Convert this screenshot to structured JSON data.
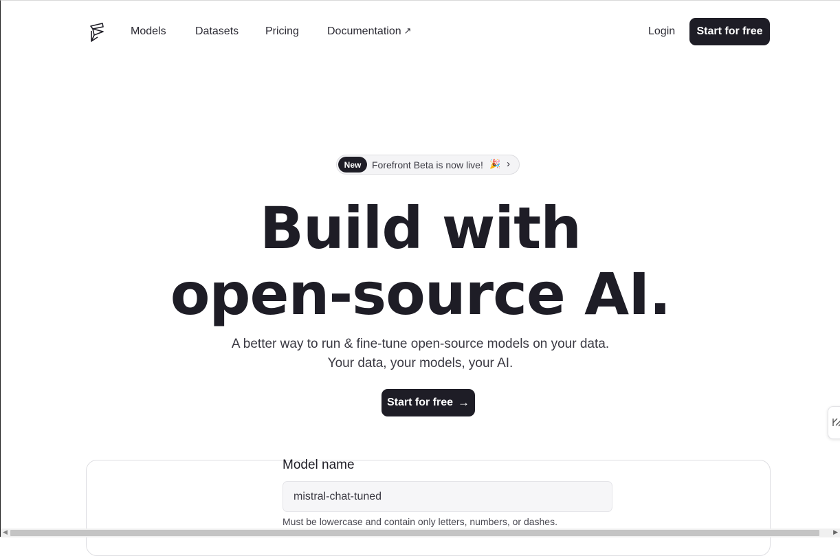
{
  "nav": {
    "links": [
      "Models",
      "Datasets",
      "Pricing",
      "Documentation"
    ],
    "login": "Login",
    "cta": "Start for free"
  },
  "announcement": {
    "badge": "New",
    "text": "Forefront Beta is now live!",
    "emoji": "🎉",
    "chevron": "›"
  },
  "hero": {
    "line1": "Build with",
    "line2": "open-source AI.",
    "sub1": "A better way to run & fine-tune open-source models on your data.",
    "sub2": "Your data, your models, your AI.",
    "cta": "Start for free"
  },
  "form": {
    "label": "Model name",
    "value": "mistral-chat-tuned",
    "hint": "Must be lowercase and contain only letters, numbers, or dashes."
  },
  "icons": {
    "logo": "forefront-logo",
    "external": "external-link-icon",
    "arrow": "arrow-right-icon",
    "side": "feedback-tab-icon"
  },
  "colors": {
    "dark": "#1e1d26",
    "text": "#2b2a33",
    "pill_bg": "#f4f4f6",
    "border": "#dedee2"
  }
}
